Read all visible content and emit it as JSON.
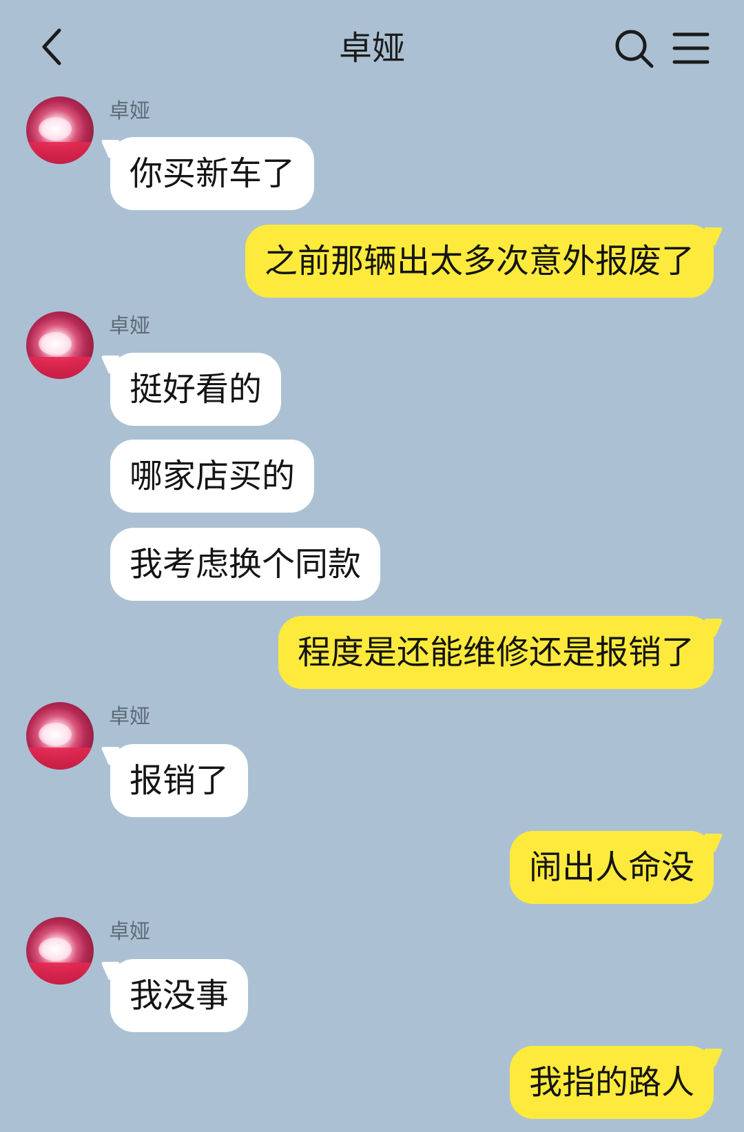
{
  "header": {
    "title": "卓娅",
    "back_icon": "chevron-left-icon",
    "search_icon": "search-icon",
    "menu_icon": "menu-icon"
  },
  "contact": {
    "name": "卓娅"
  },
  "colors": {
    "background": "#abc1d3",
    "incoming_bubble": "#ffffff",
    "outgoing_bubble": "#fdea3c"
  },
  "messages": [
    {
      "from": "contact",
      "text": "你买新车了"
    },
    {
      "from": "me",
      "text": "之前那辆出太多次意外报废了"
    },
    {
      "from": "contact",
      "text": "挺好看的"
    },
    {
      "from": "contact",
      "text": "哪家店买的"
    },
    {
      "from": "contact",
      "text": "我考虑换个同款"
    },
    {
      "from": "me",
      "text": "程度是还能维修还是报销了"
    },
    {
      "from": "contact",
      "text": "报销了"
    },
    {
      "from": "me",
      "text": "闹出人命没"
    },
    {
      "from": "contact",
      "text": "我没事"
    },
    {
      "from": "me",
      "text": "我指的路人"
    }
  ]
}
